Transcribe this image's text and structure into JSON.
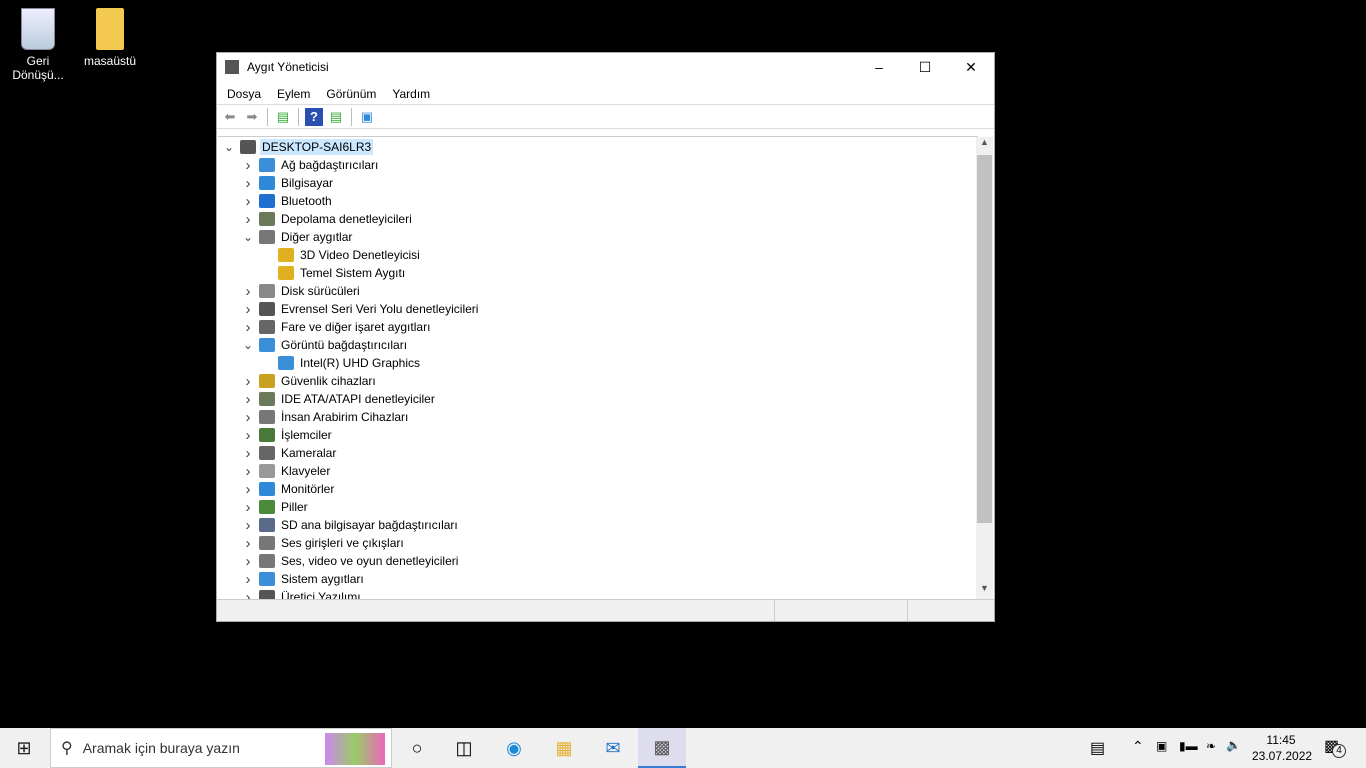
{
  "desktop": {
    "icons": [
      {
        "label": "Geri Dönüşü...",
        "icon": "recycle-bin-icon"
      },
      {
        "label": "masaüstü",
        "icon": "folder-icon"
      }
    ]
  },
  "window": {
    "title": "Aygıt Yöneticisi",
    "menu": [
      "Dosya",
      "Eylem",
      "Görünüm",
      "Yardım"
    ],
    "toolbar": [
      "back-icon",
      "forward-icon",
      "show-hide-console-tree-icon",
      "help-icon",
      "action-pane-icon",
      "scan-hardware-icon"
    ],
    "tree": [
      {
        "label": "DESKTOP-SAI6LR3",
        "level": 0,
        "expanded": true,
        "selected": true,
        "icon": "computer-root-icon",
        "color": "#555"
      },
      {
        "label": "Ağ bağdaştırıcıları",
        "level": 1,
        "expanded": false,
        "icon": "network-icon",
        "color": "#3a8fd8"
      },
      {
        "label": "Bilgisayar",
        "level": 1,
        "expanded": false,
        "icon": "monitor-icon",
        "color": "#2e8ad8"
      },
      {
        "label": "Bluetooth",
        "level": 1,
        "expanded": false,
        "icon": "bluetooth-icon",
        "color": "#1e6fd0"
      },
      {
        "label": "Depolama denetleyicileri",
        "level": 1,
        "expanded": false,
        "icon": "storage-icon",
        "color": "#6a7a5a"
      },
      {
        "label": "Diğer aygıtlar",
        "level": 1,
        "expanded": true,
        "icon": "unknown-device-icon",
        "color": "#777"
      },
      {
        "label": "3D Video Denetleyicisi",
        "level": 2,
        "icon": "warning-device-icon",
        "color": "#e0b020"
      },
      {
        "label": "Temel Sistem Aygıtı",
        "level": 2,
        "icon": "warning-device-icon",
        "color": "#e0b020"
      },
      {
        "label": "Disk sürücüleri",
        "level": 1,
        "expanded": false,
        "icon": "disk-icon",
        "color": "#888"
      },
      {
        "label": "Evrensel Seri Veri Yolu denetleyicileri",
        "level": 1,
        "expanded": false,
        "icon": "usb-icon",
        "color": "#555"
      },
      {
        "label": "Fare ve diğer işaret aygıtları",
        "level": 1,
        "expanded": false,
        "icon": "mouse-icon",
        "color": "#666"
      },
      {
        "label": "Görüntü bağdaştırıcıları",
        "level": 1,
        "expanded": true,
        "icon": "display-adapter-icon",
        "color": "#3a8fd8"
      },
      {
        "label": "Intel(R) UHD Graphics",
        "level": 2,
        "icon": "display-adapter-icon",
        "color": "#3a8fd8"
      },
      {
        "label": "Güvenlik cihazları",
        "level": 1,
        "expanded": false,
        "icon": "security-key-icon",
        "color": "#c9a020"
      },
      {
        "label": "IDE ATA/ATAPI denetleyiciler",
        "level": 1,
        "expanded": false,
        "icon": "ide-icon",
        "color": "#6a7a5a"
      },
      {
        "label": "İnsan Arabirim Cihazları",
        "level": 1,
        "expanded": false,
        "icon": "hid-icon",
        "color": "#777"
      },
      {
        "label": "İşlemciler",
        "level": 1,
        "expanded": false,
        "icon": "cpu-icon",
        "color": "#4a7a3a"
      },
      {
        "label": "Kameralar",
        "level": 1,
        "expanded": false,
        "icon": "camera-icon",
        "color": "#666"
      },
      {
        "label": "Klavyeler",
        "level": 1,
        "expanded": false,
        "icon": "keyboard-icon",
        "color": "#999"
      },
      {
        "label": "Monitörler",
        "level": 1,
        "expanded": false,
        "icon": "monitor-icon",
        "color": "#2e8ad8"
      },
      {
        "label": "Piller",
        "level": 1,
        "expanded": false,
        "icon": "battery-icon",
        "color": "#4a8a3a"
      },
      {
        "label": "SD ana bilgisayar bağdaştırıcıları",
        "level": 1,
        "expanded": false,
        "icon": "sd-host-icon",
        "color": "#5a6a8a"
      },
      {
        "label": "Ses girişleri ve çıkışları",
        "level": 1,
        "expanded": false,
        "icon": "speaker-icon",
        "color": "#777"
      },
      {
        "label": "Ses, video ve oyun denetleyicileri",
        "level": 1,
        "expanded": false,
        "icon": "speaker-icon",
        "color": "#777"
      },
      {
        "label": "Sistem aygıtları",
        "level": 1,
        "expanded": false,
        "icon": "system-devices-icon",
        "color": "#3a8fd8"
      },
      {
        "label": "Üretici Yazılımı",
        "level": 1,
        "expanded": false,
        "icon": "firmware-icon",
        "color": "#555"
      }
    ]
  },
  "taskbar": {
    "search_placeholder": "Aramak için buraya yazın",
    "time": "11:45",
    "date": "23.07.2022",
    "notification_count": "4"
  }
}
